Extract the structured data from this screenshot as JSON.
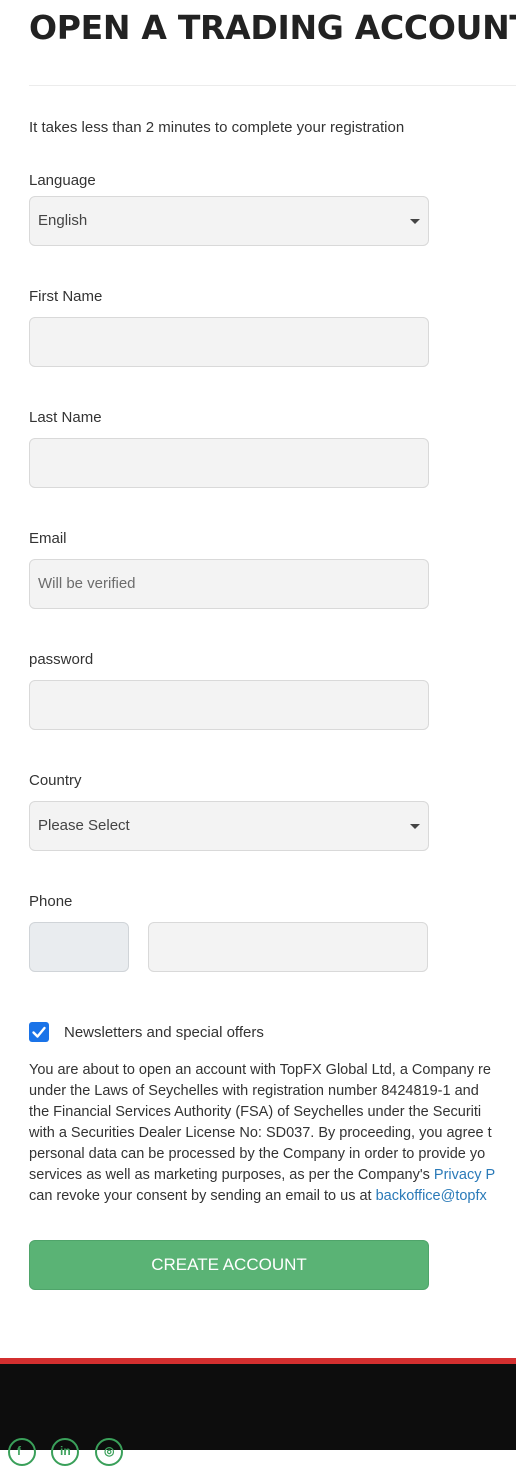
{
  "header": {
    "title": "OPEN A TRADING ACCOUNT"
  },
  "intro": "It takes less than 2 minutes to complete your registration",
  "form": {
    "language": {
      "label": "Language",
      "value": "English"
    },
    "first_name": {
      "label": "First Name",
      "value": ""
    },
    "last_name": {
      "label": "Last Name",
      "value": ""
    },
    "email": {
      "label": "Email",
      "placeholder": "Will be verified"
    },
    "password": {
      "label": "password",
      "value": ""
    },
    "country": {
      "label": "Country",
      "value": "Please Select"
    },
    "phone": {
      "label": "Phone"
    },
    "newsletter": {
      "label": "Newsletters and special offers",
      "checked": true
    }
  },
  "consent": {
    "lines": [
      "You are about to open an account with TopFX Global Ltd, a Company re",
      "under the Laws of Seychelles with registration number 8424819-1 and",
      "the Financial Services Authority (FSA) of Seychelles under the Securiti",
      "with a Securities Dealer License No: SD037. By proceeding, you agree t",
      "personal data can be processed by the Company in order to provide yo"
    ],
    "line6_text": "services as well as marketing purposes, as per the Company's ",
    "privacy_link": "Privacy P",
    "line7_text": "can revoke your consent by sending an email to us at ",
    "email_link": "backoffice@topfx"
  },
  "actions": {
    "create_label": "CREATE ACCOUNT"
  },
  "colors": {
    "accent_button": "#5ab375",
    "checkbox": "#1a73e8",
    "footer_band": "#d32f2f",
    "link": "#2a7ab8"
  },
  "footer": {
    "social_icons": [
      "facebook-icon",
      "linkedin-icon",
      "instagram-icon"
    ]
  }
}
